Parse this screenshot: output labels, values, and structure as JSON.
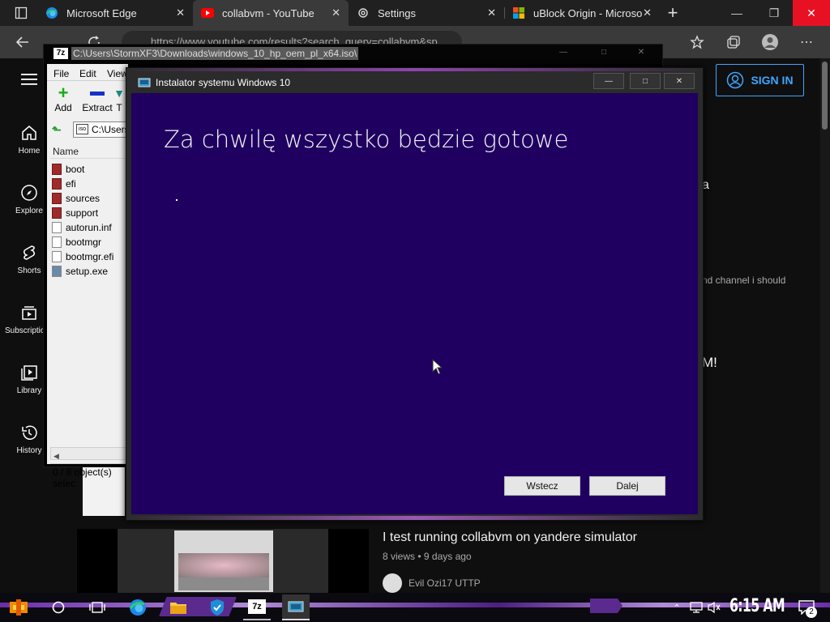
{
  "browser": {
    "tabs": [
      {
        "title": "Microsoft Edge",
        "icon": "edge-icon"
      },
      {
        "title": "collabvm - YouTube",
        "icon": "youtube-icon"
      },
      {
        "title": "Settings",
        "icon": "gear-icon"
      },
      {
        "title": "uBlock Origin - Microso",
        "icon": "microsoft-icon"
      }
    ],
    "close_glyph": "✕",
    "new_tab": "+",
    "url": "https://www.youtube.com/results?search_query=collabvm&sp"
  },
  "youtube": {
    "sidebar": [
      {
        "label": "Home"
      },
      {
        "label": "Explore"
      },
      {
        "label": "Shorts"
      },
      {
        "label": "Subscriptions"
      },
      {
        "label": "Library"
      },
      {
        "label": "History"
      }
    ],
    "sign_in": "SIGN IN",
    "partial_texts": [
      "a",
      "nd channel i should",
      "M!"
    ],
    "video": {
      "title": "I test running collabvm on yandere simulator",
      "meta": "8 views • 9 days ago",
      "channel": "Evil Ozi17 UTTP"
    }
  },
  "sevenzip": {
    "title_path": "C:\\Users\\StormXF3\\Downloads\\windows_10_hp_oem_pl_x64.iso\\",
    "logo": "7z",
    "menu": [
      "File",
      "Edit",
      "View"
    ],
    "toolbar": [
      "Add",
      "Extract",
      "T"
    ],
    "address": "C:\\Users",
    "column": "Name",
    "files": [
      {
        "name": "boot",
        "kind": "folder-iso"
      },
      {
        "name": "efi",
        "kind": "folder-iso"
      },
      {
        "name": "sources",
        "kind": "folder-iso"
      },
      {
        "name": "support",
        "kind": "folder-iso"
      },
      {
        "name": "autorun.inf",
        "kind": "file"
      },
      {
        "name": "bootmgr",
        "kind": "file"
      },
      {
        "name": "bootmgr.efi",
        "kind": "file"
      },
      {
        "name": "setup.exe",
        "kind": "exe"
      }
    ],
    "status": "0 / 8 object(s) selec"
  },
  "installer": {
    "title": "Instalator systemu Windows 10",
    "heading": "Za chwilę wszystko będzie gotowe",
    "back_button": "Wstecz",
    "next_button": "Dalej"
  },
  "taskbar": {
    "clock": "6:15 AM",
    "notifications": "2",
    "seven_zip_label": "7z"
  },
  "colors": {
    "installer_bg": "#1f0060",
    "accent_purple": "#8e44ad",
    "youtube_red": "#ff0000",
    "signin_blue": "#3ea6ff",
    "edge_close_red": "#e81123"
  }
}
